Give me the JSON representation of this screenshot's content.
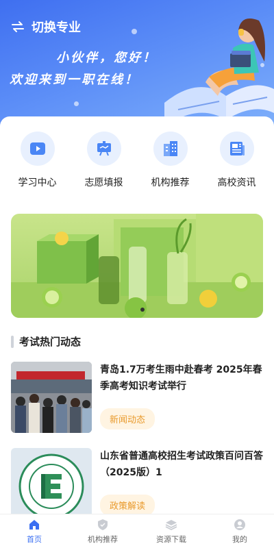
{
  "header": {
    "switch_label": "切换专业",
    "greeting_line1": "小伙伴，您好！",
    "greeting_line2": "欢迎来到一职在线！"
  },
  "quick_links": [
    {
      "label": "学习中心",
      "icon": "play-video-icon"
    },
    {
      "label": "志愿填报",
      "icon": "presentation-board-icon"
    },
    {
      "label": "机构推荐",
      "icon": "building-icon"
    },
    {
      "label": "高校资讯",
      "icon": "newspaper-icon"
    }
  ],
  "section": {
    "title": "考试热门动态"
  },
  "news": [
    {
      "title": "青岛1.7万考生雨中赴春考 2025年春季高考知识考试举行",
      "tag": "新闻动态"
    },
    {
      "title": "山东省普通高校招生考试政策百问百答 （2025版）1",
      "tag": "政策解读"
    }
  ],
  "tabbar": {
    "items": [
      {
        "label": "首页",
        "icon": "home-icon",
        "active": true
      },
      {
        "label": "机构推荐",
        "icon": "shield-icon",
        "active": false
      },
      {
        "label": "资源下载",
        "icon": "layers-icon",
        "active": false
      },
      {
        "label": "我的",
        "icon": "user-icon",
        "active": false
      }
    ]
  },
  "colors": {
    "accent": "#3b6ff2",
    "tag_text": "#e99a2c",
    "tag_bg": "#fff4e2"
  }
}
